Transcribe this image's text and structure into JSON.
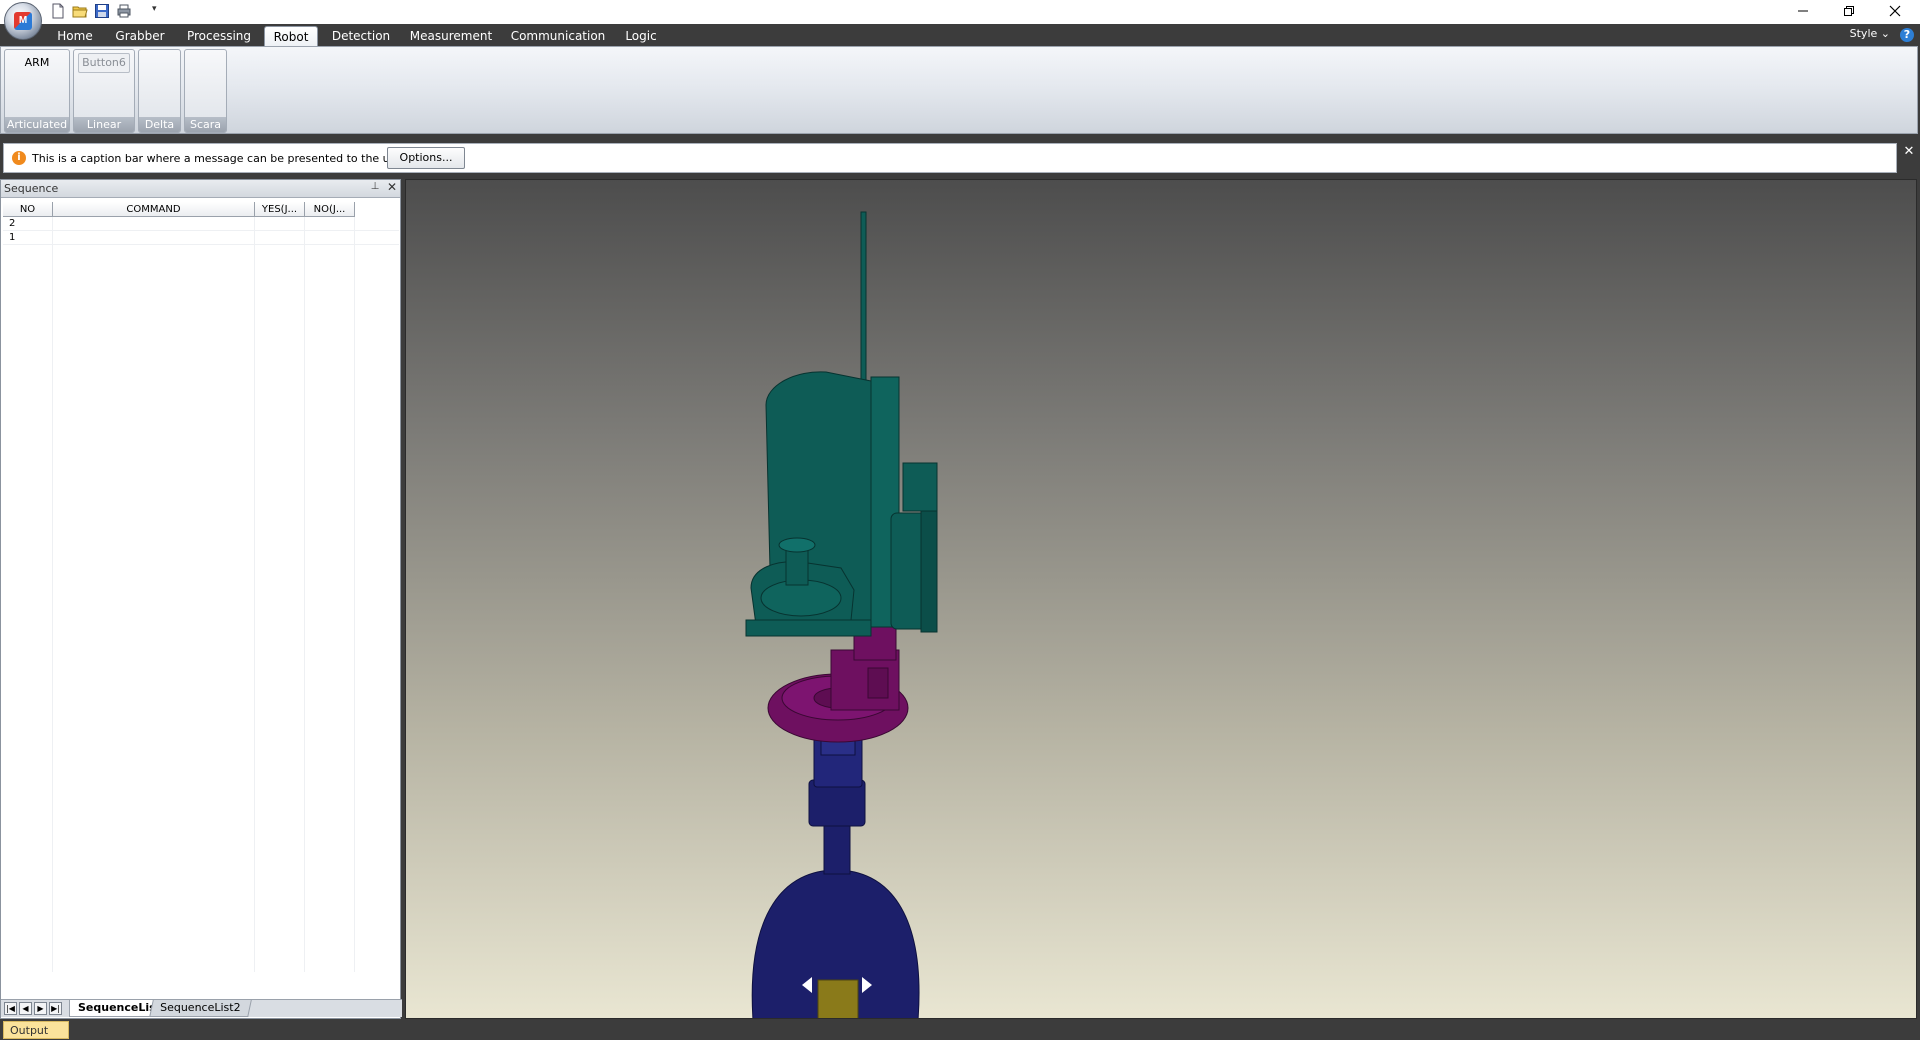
{
  "app": {
    "quick_access": [
      "new-icon",
      "open-icon",
      "save-icon",
      "print-icon"
    ],
    "window_controls": [
      "minimize-icon",
      "restore-icon",
      "close-icon"
    ]
  },
  "ribbon": {
    "tabs": [
      {
        "label": "Home"
      },
      {
        "label": "Grabber"
      },
      {
        "label": "Processing"
      },
      {
        "label": "Robot",
        "active": true
      },
      {
        "label": "Detection"
      },
      {
        "label": "Measurement"
      },
      {
        "label": "Communication"
      },
      {
        "label": "Logic"
      }
    ],
    "style_label": "Style",
    "style_chevron": "⌄",
    "help_glyph": "?",
    "groups": [
      {
        "caption": "Articulated",
        "button_label": "ARM"
      },
      {
        "caption": "Linear",
        "button_label": "Button6"
      },
      {
        "caption": "Delta"
      },
      {
        "caption": "Scara"
      }
    ]
  },
  "message_bar": {
    "text": "This is a caption bar where a message can be presented to the user.",
    "options_label": "Options...",
    "close_glyph": "✕",
    "info_glyph": "i"
  },
  "sequence": {
    "title": "Sequence",
    "columns": [
      "NO",
      "COMMAND",
      "YES(J...",
      "NO(J..."
    ],
    "rows": [
      {
        "no": "2",
        "command": "",
        "yes": "",
        "no_jump": ""
      },
      {
        "no": "1",
        "command": "",
        "yes": "",
        "no_jump": ""
      }
    ],
    "sheets": [
      {
        "label": "SequenceList",
        "active": true
      },
      {
        "label": "SequenceList2",
        "active": false
      }
    ],
    "pin_glyph": "⊥",
    "close_glyph": "✕",
    "nav": [
      "first-icon",
      "prev-icon",
      "next-icon",
      "last-icon"
    ]
  },
  "viewport": {
    "colors": {
      "top_link": "#0e5c56",
      "elbow": "#6e1060",
      "base": "#1c1f6a",
      "base_detail": "#8a7a1a"
    }
  },
  "status": {
    "output_label": "Output"
  }
}
